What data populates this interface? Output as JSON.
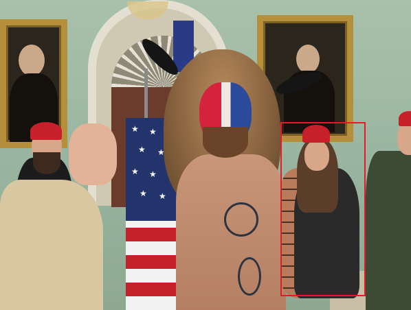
{
  "image": {
    "caption": "",
    "colors": {
      "wall": "#9bb5a0",
      "gold_frame": "#b58f3c",
      "highlight": "#e01b2a",
      "flag_red": "#c4202c",
      "flag_blue": "#23336b",
      "cap_red": "#c8202a",
      "fur": "#8a6440"
    },
    "elements": [
      "portrait-painting-left",
      "portrait-painting-right",
      "arched-doorway",
      "american-flag",
      "fur-hat-with-horns",
      "painted-face",
      "red-cap",
      "red-highlight-box"
    ]
  }
}
